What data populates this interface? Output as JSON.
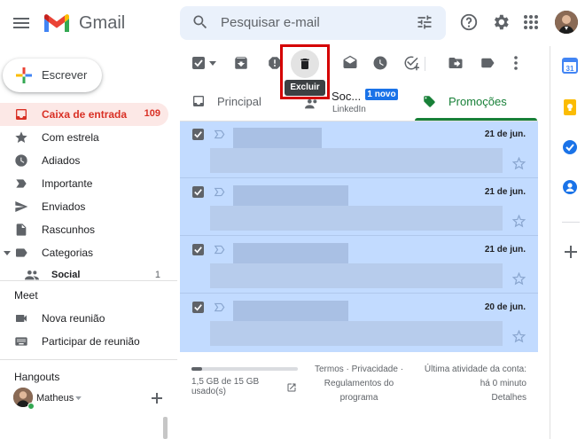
{
  "header": {
    "app_name": "Gmail",
    "search_placeholder": "Pesquisar e-mail"
  },
  "sidebar": {
    "compose_label": "Escrever",
    "items": [
      {
        "label": "Caixa de entrada",
        "count": "109",
        "icon": "inbox-icon"
      },
      {
        "label": "Com estrela",
        "count": "",
        "icon": "star-icon"
      },
      {
        "label": "Adiados",
        "count": "",
        "icon": "clock-icon"
      },
      {
        "label": "Importante",
        "count": "",
        "icon": "label-important-icon"
      },
      {
        "label": "Enviados",
        "count": "",
        "icon": "send-icon"
      },
      {
        "label": "Rascunhos",
        "count": "",
        "icon": "draft-icon"
      },
      {
        "label": "Categorias",
        "count": "",
        "icon": "label-icon"
      },
      {
        "label": "Social",
        "count": "1",
        "icon": "people-icon"
      }
    ],
    "meet": {
      "title": "Meet",
      "items": [
        {
          "label": "Nova reunião",
          "icon": "video-icon"
        },
        {
          "label": "Participar de reunião",
          "icon": "keyboard-icon"
        }
      ]
    },
    "hangouts": {
      "title": "Hangouts",
      "user": "Matheus"
    }
  },
  "toolbar": {
    "tooltip": "Excluir"
  },
  "tabs": [
    {
      "label": "Principal",
      "sub": "",
      "badge": ""
    },
    {
      "label": "Soc...",
      "sub": "LinkedIn",
      "badge": "1 novo"
    },
    {
      "label": "Promoções",
      "sub": "",
      "badge": ""
    }
  ],
  "emails": [
    {
      "date": "21 de jun."
    },
    {
      "date": "21 de jun."
    },
    {
      "date": "21 de jun."
    },
    {
      "date": "20 de jun."
    }
  ],
  "footer": {
    "storage_line1": "1,5 GB de 15 GB",
    "storage_line2": "usado(s)",
    "storage_fraction": 0.1,
    "terms": "Termos",
    "privacy": "Privacidade",
    "program_line1": "Regulamentos do",
    "program_line2": "programa",
    "activity_line1": "Última atividade da conta:",
    "activity_line2": "há 0 minuto",
    "details": "Detalhes"
  },
  "colors": {
    "accent_red": "#d93025",
    "selected_row": "#c2dbff",
    "promo_green": "#188038",
    "badge_blue": "#1a73e8"
  }
}
